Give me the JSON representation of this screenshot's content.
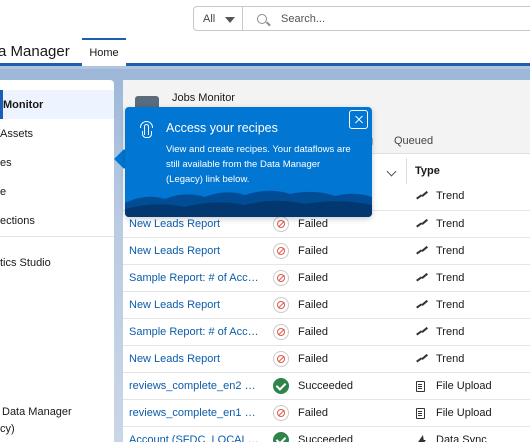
{
  "header": {
    "search_scope": "All",
    "search_placeholder": "Search..."
  },
  "appnav": {
    "app_name": "a Manager",
    "home_tab": "Home"
  },
  "sidebar": {
    "items": [
      {
        "label": "Monitor"
      },
      {
        "label": "Assets"
      },
      {
        "label": "es"
      },
      {
        "label": "e"
      },
      {
        "label": "ections"
      },
      {
        "label": "tics Studio"
      },
      {
        "label": "Data Manager"
      },
      {
        "label": "cy)"
      }
    ]
  },
  "card": {
    "title": "Jobs Monitor",
    "tab_partial": "g",
    "tab_queued": "Queued",
    "column_type": "Type"
  },
  "popover": {
    "title": "Access your recipes",
    "body": "View and create recipes. Your dataflows are still available from the Data Manager (Legacy) link below."
  },
  "rows": [
    {
      "name": "New Leads Report",
      "status": "Failed",
      "status_kind": "failed",
      "type": "Trend",
      "type_icon": "trend-icon"
    },
    {
      "name": "New Leads Report",
      "status": "Failed",
      "status_kind": "failed",
      "type": "Trend",
      "type_icon": "trend-icon"
    },
    {
      "name": "Sample Report: # of Acco...",
      "status": "Failed",
      "status_kind": "failed",
      "type": "Trend",
      "type_icon": "trend-icon"
    },
    {
      "name": "New Leads Report",
      "status": "Failed",
      "status_kind": "failed",
      "type": "Trend",
      "type_icon": "trend-icon"
    },
    {
      "name": "Sample Report: # of Acco...",
      "status": "Failed",
      "status_kind": "failed",
      "type": "Trend",
      "type_icon": "trend-icon"
    },
    {
      "name": "New Leads Report",
      "status": "Failed",
      "status_kind": "failed",
      "type": "Trend",
      "type_icon": "trend-icon"
    },
    {
      "name": "reviews_complete_en2 Up...",
      "status": "Succeeded",
      "status_kind": "ok",
      "type": "File Upload",
      "type_icon": "file-icon"
    },
    {
      "name": "reviews_complete_en1 Upl...",
      "status": "Failed",
      "status_kind": "failed",
      "type": "File Upload",
      "type_icon": "file-icon"
    },
    {
      "name": "Account (SFDC_LOCAL_L...",
      "status": "Succeeded",
      "status_kind": "ok",
      "type": "Data Sync",
      "type_icon": "bolt-icon"
    }
  ],
  "top_row_type": "Trend",
  "colors": {
    "brand_blue": "#0176d3",
    "link_blue": "#0b5cab",
    "success_green": "#2e844a",
    "error_red": "#e0584a"
  }
}
